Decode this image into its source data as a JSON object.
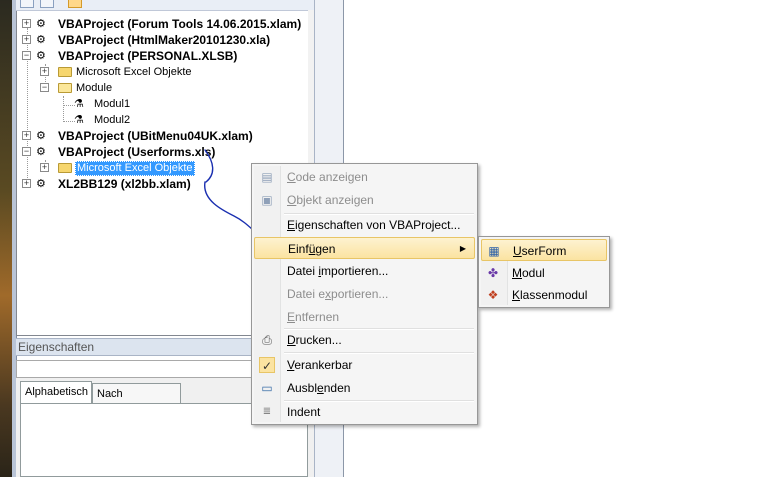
{
  "explorer": {
    "toolbar": {
      "dropdown_glyph": "▾"
    },
    "projects": [
      {
        "label": "VBAProject (Forum Tools 14.06.2015.xlam)",
        "expander": "+"
      },
      {
        "label": "VBAProject (HtmlMaker20101230.xla)",
        "expander": "+"
      },
      {
        "label": "VBAProject (PERSONAL.XLSB)",
        "expander": "−"
      },
      {
        "label": "VBAProject (UBitMenu04UK.xlam)",
        "expander": "+"
      },
      {
        "label": "VBAProject (Userforms.xls)",
        "expander": "−"
      },
      {
        "label": "XL2BB129 (xl2bb.xlam)",
        "expander": "+"
      }
    ],
    "personal_children": {
      "excel_objects": "Microsoft Excel Objekte",
      "module_folder": "Module",
      "modules": [
        "Modul1",
        "Modul2"
      ]
    },
    "userforms_children": {
      "excel_objects": "Microsoft Excel Objekte"
    }
  },
  "properties": {
    "title": "Eigenschaften",
    "tabs": [
      "Alphabetisch",
      "Nach Kategorien"
    ]
  },
  "context_menu": {
    "items": [
      {
        "pre": "",
        "accel": "C",
        "post": "ode anzeigen",
        "disabled": true,
        "icon": "code-icon"
      },
      {
        "pre": "",
        "accel": "O",
        "post": "bjekt anzeigen",
        "disabled": true,
        "icon": "object-icon"
      },
      {
        "pre": "",
        "accel": "E",
        "post": "igenschaften von VBAProject...",
        "disabled": false,
        "icon": ""
      },
      {
        "pre": "Einf",
        "accel": "ü",
        "post": "gen",
        "disabled": false,
        "icon": ""
      },
      {
        "pre": "Datei ",
        "accel": "i",
        "post": "mportieren...",
        "disabled": false,
        "icon": ""
      },
      {
        "pre": "Datei e",
        "accel": "x",
        "post": "portieren...",
        "disabled": true,
        "icon": ""
      },
      {
        "pre": "",
        "accel": "E",
        "post": "ntfernen",
        "disabled": true,
        "icon": ""
      },
      {
        "pre": "",
        "accel": "D",
        "post": "rucken...",
        "disabled": false,
        "icon": "printer-icon"
      },
      {
        "pre": "",
        "accel": "V",
        "post": "erankerbar",
        "disabled": false,
        "icon": "checkmark-icon"
      },
      {
        "pre": "Ausbl",
        "accel": "e",
        "post": "nden",
        "disabled": false,
        "icon": "window-icon"
      },
      {
        "pre": "Indent",
        "accel": "",
        "post": "",
        "disabled": false,
        "icon": "indent-icon"
      }
    ],
    "submenu_arrow": "▶"
  },
  "submenu": {
    "items": [
      {
        "pre": "",
        "accel": "U",
        "post": "serForm",
        "icon": "userform-icon"
      },
      {
        "pre": "",
        "accel": "M",
        "post": "odul",
        "icon": "module-icon"
      },
      {
        "pre": "",
        "accel": "K",
        "post": "lassenmodul",
        "icon": "class-module-icon"
      }
    ]
  },
  "colors": {
    "selection": "#3399ff",
    "menu_highlight": "#fbe3a1",
    "annotation_stroke": "#1a2fb0"
  }
}
